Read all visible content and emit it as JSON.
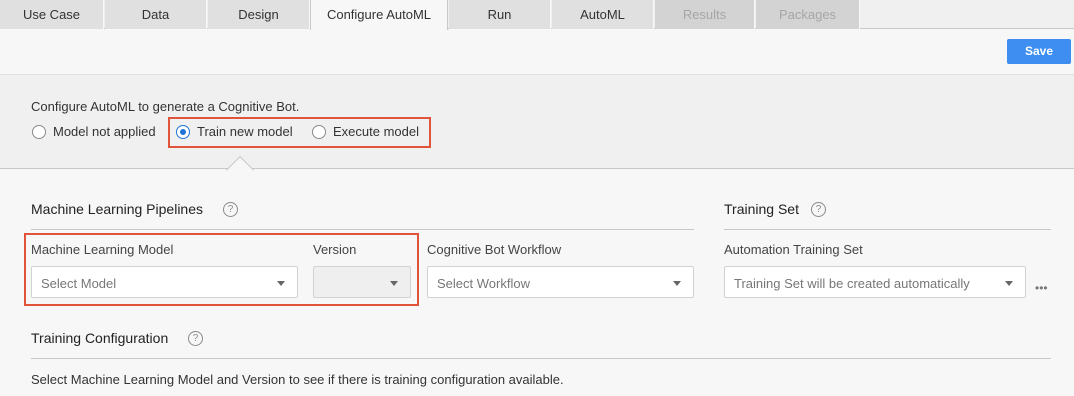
{
  "tabs": [
    {
      "label": "Use Case",
      "state": "disabled"
    },
    {
      "label": "Data",
      "state": "normal"
    },
    {
      "label": "Design",
      "state": "normal"
    },
    {
      "label": "Configure AutoML",
      "state": "active"
    },
    {
      "label": "Run",
      "state": "normal"
    },
    {
      "label": "AutoML",
      "state": "normal"
    },
    {
      "label": "Results",
      "state": "disabled"
    },
    {
      "label": "Packages",
      "state": "disabled"
    }
  ],
  "save_label": "Save",
  "configure": {
    "description": "Configure AutoML to generate a Cognitive Bot.",
    "options": [
      {
        "label": "Model not applied",
        "checked": false
      },
      {
        "label": "Train new model",
        "checked": true
      },
      {
        "label": "Execute model",
        "checked": false
      }
    ]
  },
  "pipelines": {
    "title": "Machine Learning Pipelines",
    "model_label": "Machine Learning Model",
    "model_placeholder": "Select Model",
    "version_label": "Version",
    "version_placeholder": "",
    "workflow_label": "Cognitive Bot Workflow",
    "workflow_placeholder": "Select Workflow"
  },
  "training_set": {
    "title": "Training Set",
    "label": "Automation Training Set",
    "placeholder": "Training Set will be created automatically"
  },
  "training_config": {
    "title": "Training Configuration",
    "note": "Select Machine Learning Model and Version to see if there is training configuration available."
  },
  "colors": {
    "accent": "#3d8ef0",
    "highlight": "#e0553a",
    "radio_checked": "#1e73d6"
  },
  "icons": {
    "help": "help-circle-icon",
    "dropdown": "chevron-down-icon",
    "more": "more-horizontal-icon"
  }
}
